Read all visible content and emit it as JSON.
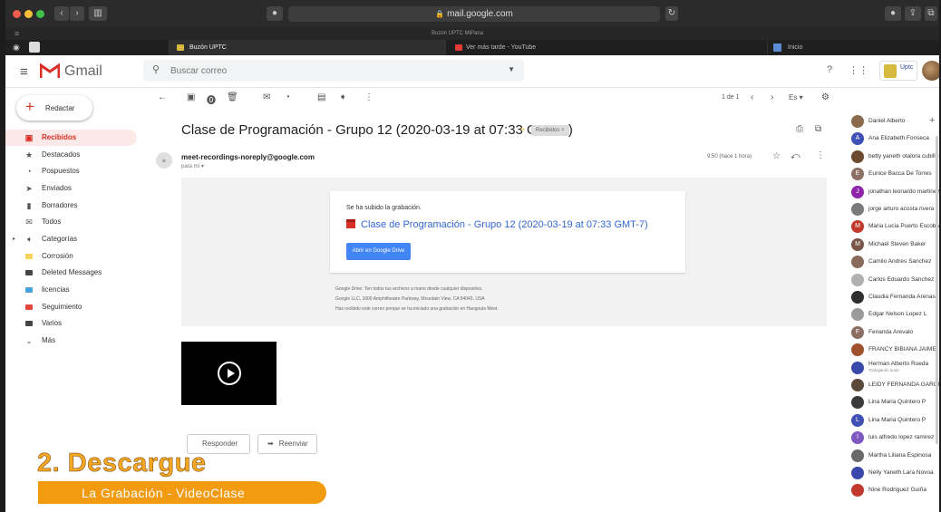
{
  "browser": {
    "url": "mail.google.com",
    "bookmarks": "Buzón UPTC   MiPana",
    "tabs": [
      {
        "label": "Buzón UPTC"
      },
      {
        "label": "Ver más tarde - YouTube"
      },
      {
        "label": "Inicio"
      }
    ]
  },
  "header": {
    "product": "Gmail",
    "search_placeholder": "Buscar correo",
    "institution_badge": "Uptc"
  },
  "sidebar": {
    "compose_label": "Redactar",
    "items": [
      {
        "label": "Recibidos",
        "icon": "inbox-icon"
      },
      {
        "label": "Destacados",
        "icon": "star-icon"
      },
      {
        "label": "Pospuestos",
        "icon": "clock-icon"
      },
      {
        "label": "Enviados",
        "icon": "send-icon"
      },
      {
        "label": "Borradores",
        "icon": "draft-icon"
      },
      {
        "label": "Todos",
        "icon": "mail-icon"
      },
      {
        "label": "Categorías",
        "icon": "label-icon"
      },
      {
        "label": "Corrosión",
        "icon": "label-icon",
        "color": "#f6d35b"
      },
      {
        "label": "Deleted Messages",
        "icon": "label-icon"
      },
      {
        "label": "licencias",
        "icon": "label-icon",
        "color": "#4aa3df"
      },
      {
        "label": "Seguimiento",
        "icon": "label-icon",
        "color": "#e2463b"
      },
      {
        "label": "Varios",
        "icon": "label-icon"
      },
      {
        "label": "Más",
        "icon": "chevron-down-icon"
      }
    ]
  },
  "toolbar": {
    "pagination": "1 de 1",
    "lang_menu": "Es"
  },
  "message": {
    "subject": "Clase de Programación - Grupo 12 (2020-03-19 at 07:33 GMT-7)",
    "label_chip": "Recibidos ×",
    "sender": "meet-recordings-noreply@google.com",
    "to": "para mí ▾",
    "time": "9:50 (hace 1 hora)",
    "card_note": "Se ha subido la grabación.",
    "file_name": "Clase de Programación - Grupo 12 (2020-03-19 at 07:33 GMT-7)",
    "open_button": "Abrir en Google Drive",
    "footer": [
      "Google Drive: Ten todos tus archivos a mano desde cualquier dispositivo.",
      "Google LLC, 1600 Amphitheatre Parkway, Mountain View, CA 94043, USA",
      "Has recibido este correo porque se ha iniciado una grabación en Hangouts Meet."
    ],
    "reply_label": "Responder",
    "forward_label": "Reenviar"
  },
  "overlay": {
    "title": "2. Descargue",
    "subtitle": "La Grabación - VideoClase"
  },
  "contacts": [
    {
      "name": "Daniel Alberto ·",
      "color": "#8a6a4a"
    },
    {
      "name": "Ana Elizabeth Fonseca",
      "initial": "A",
      "color": "#3f51b5"
    },
    {
      "name": "betty yaneth otalora cubillos",
      "color": "#6b4a2e"
    },
    {
      "name": "Eunice Bacca De Torres",
      "initial": "E",
      "color": "#8d6e63"
    },
    {
      "name": "jonathan leonardo martinez",
      "initial": "J",
      "color": "#8e24aa"
    },
    {
      "name": "jorge arturo acosta rivera",
      "color": "#7a7a7a"
    },
    {
      "name": "Maria Lucia Puerto Escobar",
      "initial": "M",
      "color": "#c0392b"
    },
    {
      "name": "Michael Steven Baker",
      "initial": "M",
      "color": "#795548"
    },
    {
      "name": "Camilo Andres Sanchez",
      "color": "#8a6a5a"
    },
    {
      "name": "Carlos Eduardo Sanchez",
      "color": "#b0b0b0"
    },
    {
      "name": "Claudia Fernanda Arenas",
      "color": "#2e2e2e"
    },
    {
      "name": "Edgar Nelson Lopez L",
      "color": "#9a9a9a"
    },
    {
      "name": "Fenanda Arevalo",
      "initial": "F",
      "color": "#8d6e63"
    },
    {
      "name": "FRANCY BIBIANA JAIME",
      "color": "#a0522d"
    },
    {
      "name": "Herman Alberto Rueda",
      "status": "Trabajando ando",
      "color": "#3949ab"
    },
    {
      "name": "LEIDY FERNANDA GARCIA",
      "color": "#5a4a3a"
    },
    {
      "name": "Lina Maria Quintero P",
      "color": "#3a3a3a"
    },
    {
      "name": "Lina Maria Quintero P",
      "initial": "L",
      "color": "#3f51b5"
    },
    {
      "name": "luis alfredo lopez ramirez",
      "initial": "l",
      "color": "#7e57c2"
    },
    {
      "name": "Martha Liliana Espinosa",
      "color": "#6a6a6a"
    },
    {
      "name": "Nelly Yaneth Lara Novoa",
      "color": "#3949ab"
    },
    {
      "name": "Nine Rodriguez Guiña",
      "color": "#c0392b"
    }
  ]
}
